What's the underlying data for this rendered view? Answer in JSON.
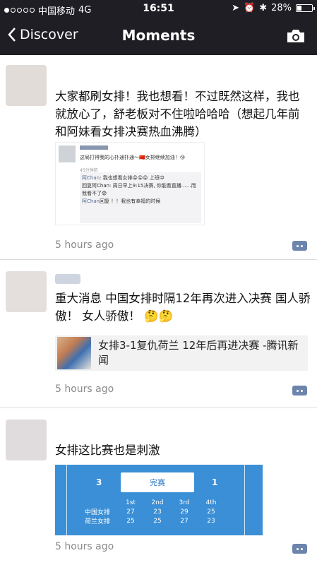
{
  "status_bar": {
    "carrier": "中国移动",
    "network": "4G",
    "time": "16:51",
    "battery": "28%",
    "battery_level": 0.28
  },
  "nav": {
    "back_label": "Discover",
    "title": "Moments"
  },
  "posts": [
    {
      "text": "大家都刷女排！我也想看！不过既然这样，我也就放心了，舒老板对不住啦哈哈哈（想起几年前和阿妹看女排决赛热血沸腾）",
      "time": "5 hours ago",
      "image": {
        "line1": "这局打得我的心扑通扑通～🇨🇳女排继续加油！😘",
        "ago": "45分钟前",
        "comments": [
          {
            "name": "阿Chan",
            "text": ": 我也想看女排😝😝😝 上班中"
          },
          {
            "name": "",
            "text": "回复阿Chan: 周日早上9:15决赛, 你能看直播……而我看不了😨"
          },
          {
            "name": "阿Chan",
            "text": "回复 ！！我也有幸福的时候"
          }
        ]
      }
    },
    {
      "text": "重大消息 中国女排时隔12年再次进入决赛 国人骄傲！ 女人骄傲！ 🤔🤔",
      "time": "5 hours ago",
      "link": {
        "title": "女排3-1复仇荷兰 12年后再进决赛 -腾讯新闻"
      }
    },
    {
      "text": "女排这比赛也是刺激",
      "time": "5 hours ago",
      "score": {
        "left_score": "3",
        "right_score": "1",
        "button": "完赛",
        "headers": [
          "",
          "1st",
          "2nd",
          "3rd",
          "4th"
        ],
        "rows": [
          [
            "中国女排",
            "27",
            "23",
            "29",
            "25"
          ],
          [
            "荷兰女排",
            "25",
            "25",
            "27",
            "23"
          ]
        ]
      }
    }
  ]
}
